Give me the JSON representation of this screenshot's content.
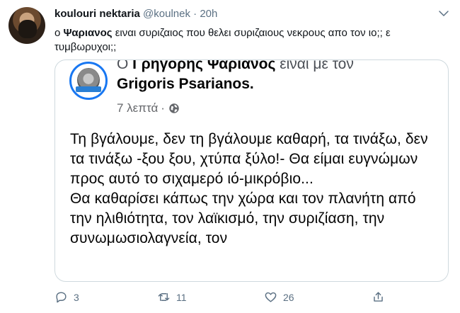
{
  "tweet": {
    "author_name": "koulouri nektaria",
    "author_handle": "@koulnek",
    "separator": "·",
    "time": "20h",
    "text_prefix": "ο ",
    "text_bold": "Ψαριανος",
    "text_rest": " ειναι συριζαιος που θελει συριζαιους νεκρους απο τον ιο;; ε τυμβωρυχοι;;",
    "reply_count": "3",
    "retweet_count": "11",
    "like_count": "26"
  },
  "embedded_post": {
    "header_prefix": "Ο ",
    "header_name": "Γρηγόρης Ψαριανός",
    "header_suffix": " είναι με τον",
    "tagged_name": "Grigoris Psarianos",
    "tagged_suffix": ".",
    "time": "7 λεπτά",
    "meta_separator": "·",
    "paragraphs": [
      "Τη βγάλουμε, δεν τη βγάλουμε καθαρή, τα τινάξω, δεν τα τινάξω -ξου ξου, χτύπα ξύλο!- Θα είμαι ευγνώμων προς αυτό το σιχαμερό ιό-μικρόβιο...",
      "Θα καθαρίσει κάπως την χώρα και τον πλανήτη από την ηλιθιότητα, τον λαϊκισμό, την συριζίαση, την συνωμωσιολαγνεία, τον"
    ]
  },
  "icons": {
    "more": "chevron-down-icon",
    "reply": "reply-icon",
    "retweet": "retweet-icon",
    "like": "heart-icon",
    "share": "share-icon",
    "audience": "globe-icon"
  },
  "colors": {
    "text": "#0f1419",
    "muted": "#5b7083",
    "border": "#cfd9de",
    "facebook_blue": "#1877f2"
  }
}
